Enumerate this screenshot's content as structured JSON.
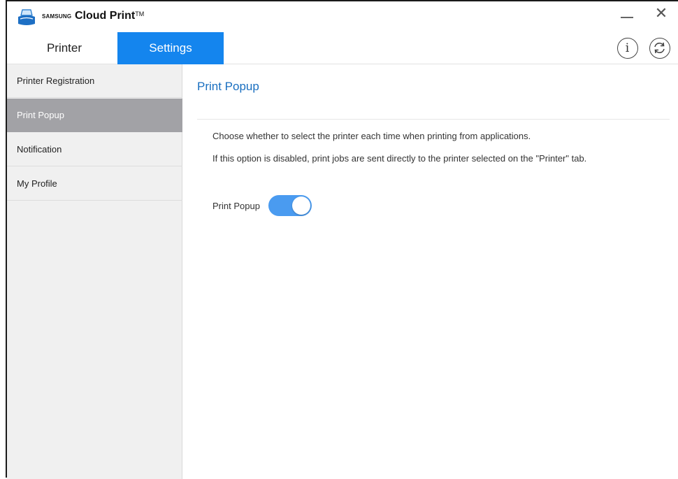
{
  "app": {
    "brand": "SAMSUNG",
    "name": "Cloud Print",
    "trademark": "TM",
    "icons": {
      "logo": "printer-logo-icon",
      "minimize": "minimize-icon",
      "close": "close-icon"
    },
    "close_glyph": "✕"
  },
  "tabs": [
    {
      "label": "Printer",
      "active": false
    },
    {
      "label": "Settings",
      "active": true
    }
  ],
  "toolbar": {
    "info_glyph": "i",
    "icons": [
      "info-icon",
      "refresh-icon"
    ]
  },
  "sidebar": {
    "items": [
      {
        "label": "Printer Registration",
        "active": false
      },
      {
        "label": "Print Popup",
        "active": true
      },
      {
        "label": "Notification",
        "active": false
      },
      {
        "label": "My Profile",
        "active": false
      }
    ]
  },
  "main": {
    "title": "Print Popup",
    "description_1": "Choose whether to select the printer each time when printing from applications.",
    "description_2": "If this option is disabled, print jobs are sent directly to the printer selected on the \"Printer\" tab.",
    "toggle": {
      "label": "Print Popup",
      "on": true
    }
  },
  "colors": {
    "accent": "#1485ee",
    "title": "#1a6fc0",
    "toggle_on": "#4a9bf0",
    "sidebar_active": "#a2a2a6"
  }
}
